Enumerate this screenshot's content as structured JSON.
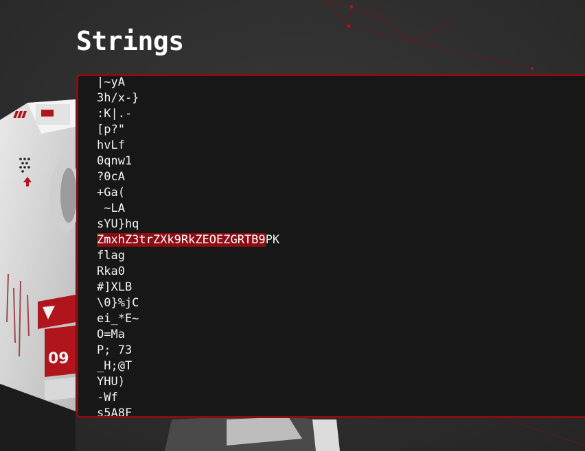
{
  "page": {
    "title": "Strings"
  },
  "strings_panel": {
    "lines": [
      "|~yA",
      "3h/x-}",
      ":K|.-",
      "[p?\"",
      "hvLf",
      "0qnw1",
      "?0cA",
      "+Ga(",
      " ~LA",
      "sYU}hq",
      "ZmxhZ3trZXk9RkZEOEZGRTB9PK",
      "flag",
      "Rka0",
      "#]XLB",
      "\\0}%jC",
      "ei_*E~",
      "O=Ma",
      "P; 73",
      "_H;@T",
      "YHU)",
      "-Wf",
      "s5A8F"
    ],
    "highlight": {
      "line_index": 10,
      "selected_text": "ZmxhZ3trZXk9RkZEOEZGRTB9",
      "rest_text": "PK"
    }
  },
  "colors": {
    "background": "#303030",
    "panel_background": "#171717",
    "panel_border": "#8a0d12",
    "highlight": "#8e0c14",
    "text": "#f2f2f2"
  }
}
